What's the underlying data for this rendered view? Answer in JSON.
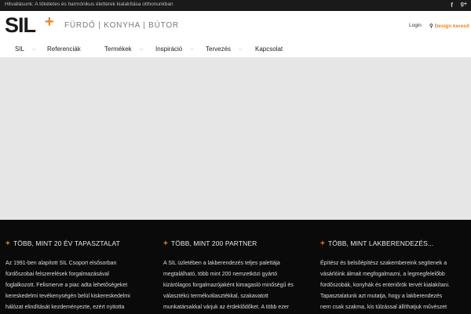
{
  "topbar": {
    "tagline": "Hitvallásunk: A tökéletes és harmónikus életterek kialakítása otthonunkban",
    "social": [
      "f",
      "g+"
    ]
  },
  "header": {
    "logo_text": "SIL",
    "logo_plus": "+",
    "slogan": "FÜRDŐ | KONYHA | BÚTOR",
    "login": "Login",
    "design_search": "Design kereső",
    "icons": {
      "search": "magnifier-icon",
      "facebook": "facebook-icon",
      "google_plus": "google-plus-icon"
    }
  },
  "nav": {
    "items": [
      {
        "label": "SIL",
        "has_dropdown": true
      },
      {
        "label": "Referenciák",
        "has_dropdown": false
      },
      {
        "label": "Termékek",
        "has_dropdown": true
      },
      {
        "label": "Inspiráció",
        "has_dropdown": true
      },
      {
        "label": "Tervezés",
        "has_dropdown": true
      },
      {
        "label": "Kapcsolat",
        "has_dropdown": false
      }
    ]
  },
  "features": [
    {
      "title": "TÖBB, MINT 20 ÉV TAPASZTALAT",
      "body": [
        "Az 1991-ben alapított SIL Csoport elsősorban",
        "fürdőszobai felszerelések forgalmazásával",
        "foglalkozott. Felismerve a piac adta lehetőségeket",
        "kereskedelmi tevékenységén belül kiskereskedelmi",
        "hálózat elindítását kezdeményezte, ezért nyitotta"
      ]
    },
    {
      "title": "TÖBB, MINT 200 PARTNER",
      "body": [
        "A SIL üzletében a lakberendezés teljes palettája",
        "megtalálható, több mint 200 nemzetközi gyártó",
        "kizárólagos forgalmazójaként kimagasló minőségű és",
        "választékú termékválasztékkal, szakavatott",
        "munkatársakkal várjuk az érdeklődőket. A több ezer"
      ]
    },
    {
      "title": "TÖBB, MINT LAKBERENDEZÉS...",
      "body": [
        "Építész és belsőépítész szakembereink segítenek a",
        "vásárlóink álmait megfogalmazni, a legmegfelelőbb",
        "fürdőszobák, konyhák és enteriőrök tervét kialakítani.",
        "Tapasztalatunk azt mutatja, hogy a lakberendezés",
        "nem csak szakma, kis túlzással állíthatjuk művészet"
      ]
    }
  ],
  "colors": {
    "accent": "#f0821e",
    "topbar": "#1a1a1a",
    "dark_section": "#0a0a0a",
    "hero": "#e6e6e6"
  }
}
